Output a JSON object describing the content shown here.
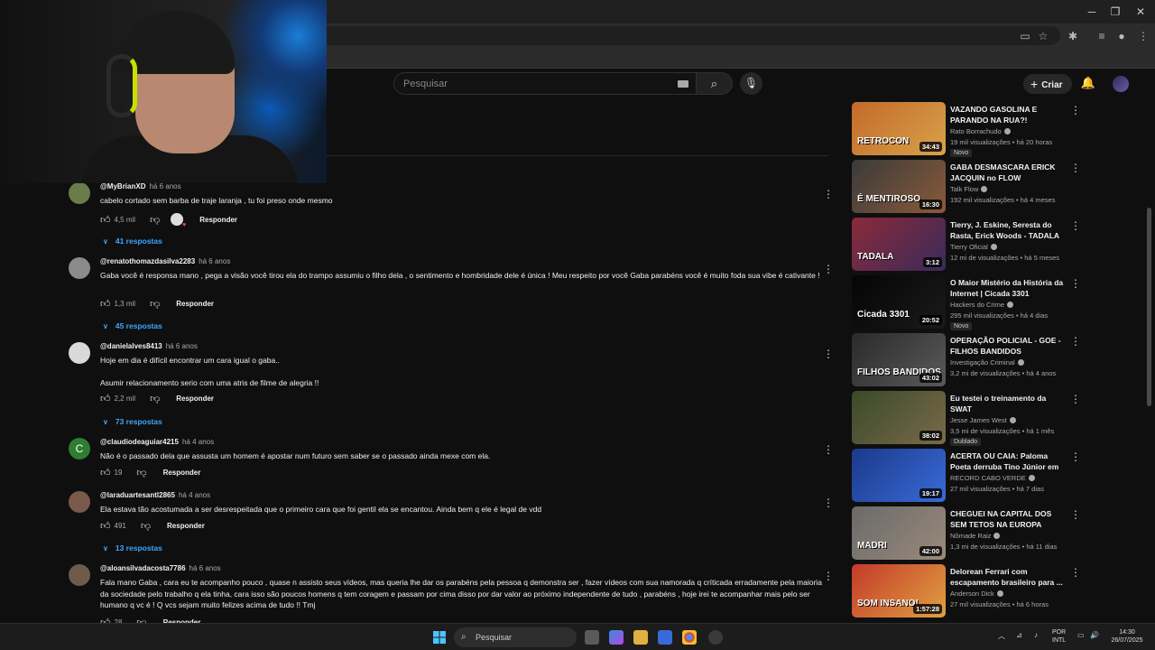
{
  "browser": {
    "window_controls": {
      "minimize": "─",
      "maximize": "❐",
      "close": "✕"
    },
    "toolbar_icons": [
      "cast-icon",
      "star-icon",
      "extensions-icon",
      "media-icon",
      "profile-icon",
      "menu-icon"
    ]
  },
  "header": {
    "search_placeholder": "Pesquisar",
    "create_label": "Criar"
  },
  "comments": [
    {
      "user": "@MyBrianXD",
      "time": "há 6 anos",
      "text": "cabelo cortado sem barba de traje laranja , tu foi preso onde mesmo",
      "likes": "4,5 mil",
      "creator_heart": true,
      "reply": "Responder",
      "replies": "41 respostas",
      "avatar_color": "#6b7b4a",
      "avatar_letter": ""
    },
    {
      "user": "@renatothomazdasilva2283",
      "time": "há 6 anos",
      "text": "Gaba você  é responsa mano , pega a visão você  tirou ela do trampo assumiu o filho dela , o sentimento e hombridade dele é única ! Meu respeito por você Gaba parabéns você é muito foda sua vibe é cativante !",
      "likes": "1,3 mil",
      "creator_heart": false,
      "reply": "Responder",
      "replies": "45 respostas",
      "avatar_color": "#8a8a8a",
      "avatar_letter": ""
    },
    {
      "user": "@danielalves8413",
      "time": "há 6 anos",
      "text": "Hoje em dia é difícil encontrar um cara igual o gaba..\n\nAsumir relacionamento serio com uma atris de filme de alegria !!",
      "likes": "2,2 mil",
      "creator_heart": false,
      "reply": "Responder",
      "replies": "73 respostas",
      "avatar_color": "#d9d9d9",
      "avatar_letter": ""
    },
    {
      "user": "@claudiodeaguiar4215",
      "time": "há 4 anos",
      "text": "Não é o passado dela que assusta um homem é apostar num futuro sem saber se o passado ainda mexe com ela.",
      "likes": "19",
      "creator_heart": false,
      "reply": "Responder",
      "replies": "",
      "avatar_color": "#2e7d32",
      "avatar_letter": "C"
    },
    {
      "user": "@laraduartesantl2865",
      "time": "há 4 anos",
      "text": "Ela estava tão acostumada a ser desrespeitada que o primeiro cara que foi gentil ela se encantou. Ainda bem q ele é legal de vdd",
      "likes": "491",
      "creator_heart": false,
      "reply": "Responder",
      "replies": "13 respostas",
      "avatar_color": "#7a5a4a",
      "avatar_letter": ""
    },
    {
      "user": "@aloansilvadacosta7786",
      "time": "há 6 anos",
      "text": "Fala mano Gaba , cara eu te acompanho pouco , quase n assisto seus vídeos, mas queria lhe dar os parabéns pela pessoa q demonstra ser , fazer vídeos com sua namorada q críticada erradamente pela maioria da sociedade pelo trabalho q ela tinha, cara isso são poucos homens q tem coragem e passam por cima disso por dar valor ao próximo independente de tudo , parabéns , hoje irei te acompanhar mais pelo ser humano q vc é ! Q vcs sejam muito felizes acima de tudo !! Tmj",
      "likes": "28",
      "creator_heart": false,
      "reply": "Responder",
      "replies": "",
      "avatar_color": "#6d5b4b",
      "avatar_letter": ""
    }
  ],
  "videos": [
    {
      "title": "VAZANDO GASOLINA E PARANDO NA RUA?! LEVAND...",
      "channel": "Rato Borrachudo",
      "views": "19 mil visualizações",
      "age": "há 20 horas",
      "duration": "34:43",
      "badge": "Novo",
      "thumb_text": "RETROCON",
      "thumb_colors": [
        "#c46a2a",
        "#d7a24a"
      ]
    },
    {
      "title": "GABA DESMASCARA ERICK JACQUIN no FLOW",
      "channel": "Talk Flow",
      "views": "192 mil visualizações",
      "age": "há 4 meses",
      "duration": "16:30",
      "badge": "",
      "thumb_text": "É MENTIROSO",
      "thumb_colors": [
        "#3a3a3a",
        "#8a5a3a"
      ]
    },
    {
      "title": "Tierry, J. Eskine, Seresta do Rasta, Erick Woods - TADALA ...",
      "channel": "Tierry Oficial",
      "views": "12 mi de visualizações",
      "age": "há 5 meses",
      "duration": "3:12",
      "badge": "",
      "thumb_text": "TADALA",
      "thumb_colors": [
        "#8a2a3a",
        "#3a2a5a"
      ]
    },
    {
      "title": "O Maior Mistério da História da Internet | Cicada 3301",
      "channel": "Hackers do Crime",
      "views": "295 mil visualizações",
      "age": "há 4 dias",
      "duration": "20:52",
      "badge": "Novo",
      "thumb_text": "Cicada 3301",
      "thumb_colors": [
        "#050505",
        "#1a1a1a"
      ]
    },
    {
      "title": "OPERAÇÃO POLICIAL - GOE - FILHOS BANDIDOS",
      "channel": "Investigação Criminal",
      "views": "3,2 mi de visualizações",
      "age": "há 4 anos",
      "duration": "43:02",
      "badge": "",
      "thumb_text": "FILHOS BANDIDOS",
      "thumb_colors": [
        "#2a2a2a",
        "#5a5a5a"
      ]
    },
    {
      "title": "Eu testei o treinamento da SWAT",
      "channel": "Jesse James West",
      "views": "3,5 mi de visualizações",
      "age": "há 1 mês",
      "duration": "38:02",
      "badge": "Dublado",
      "thumb_text": "",
      "thumb_colors": [
        "#3a4a2a",
        "#7a6a4a"
      ]
    },
    {
      "title": "ACERTA OU CAIA: Paloma Poeta derruba Tino Júnior em ...",
      "channel": "RECORD CABO VERDE",
      "views": "27 mil visualizações",
      "age": "há 7 dias",
      "duration": "19:17",
      "badge": "",
      "thumb_text": "",
      "thumb_colors": [
        "#1a3a8a",
        "#3a6ad8"
      ]
    },
    {
      "title": "CHEGUEI NA CAPITAL DOS SEM TETOS NA EUROPA",
      "channel": "Nômade Raiz",
      "views": "1,3 mi de visualizações",
      "age": "há 11 dias",
      "duration": "42:00",
      "badge": "",
      "thumb_text": "MADRI",
      "thumb_colors": [
        "#6a6a6a",
        "#9a8a7a"
      ]
    },
    {
      "title": "Delorean Ferrari com escapamento brasileiro para ...",
      "channel": "Anderson Dick",
      "views": "27 mil visualizações",
      "age": "há 6 horas",
      "duration": "1:57:28",
      "badge": "",
      "thumb_text": "SOM INSANO!",
      "thumb_colors": [
        "#c43a2a",
        "#e0a040"
      ]
    }
  ],
  "taskbar": {
    "search_label": "Pesquisar",
    "lang_top": "POR",
    "lang_bottom": "INTL",
    "time": "14:30",
    "date": "26/07/2025"
  }
}
